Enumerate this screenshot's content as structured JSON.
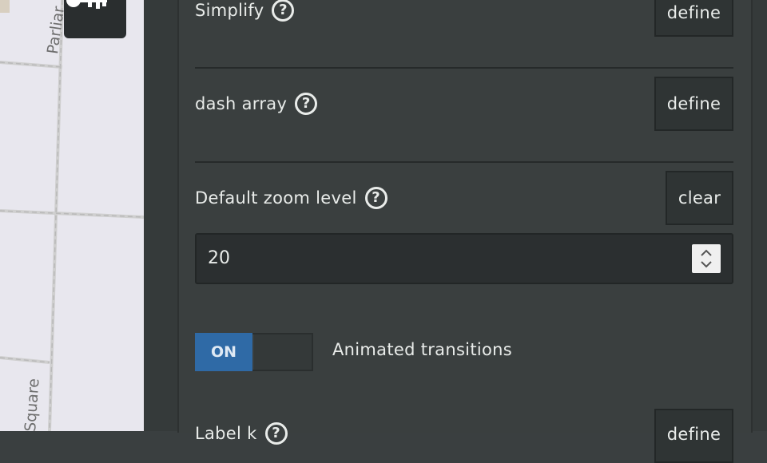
{
  "map": {
    "street_labels": [
      "Parliar",
      "Square"
    ]
  },
  "rows": [
    {
      "label": "Simplify",
      "button": "define"
    },
    {
      "label": "dash array",
      "button": "define"
    },
    {
      "label": "Default zoom level",
      "button": "clear"
    }
  ],
  "zoom_input": {
    "value": "20"
  },
  "animated_transitions": {
    "toggle_state": "ON",
    "label": "Animated transitions"
  },
  "partial_row": {
    "label": "Label k",
    "button": "define"
  },
  "colors": {
    "panel": "#3a3f3f",
    "button": "#2f3434",
    "toggle_on": "#2f6aa6",
    "map": "#e8e7ee"
  }
}
